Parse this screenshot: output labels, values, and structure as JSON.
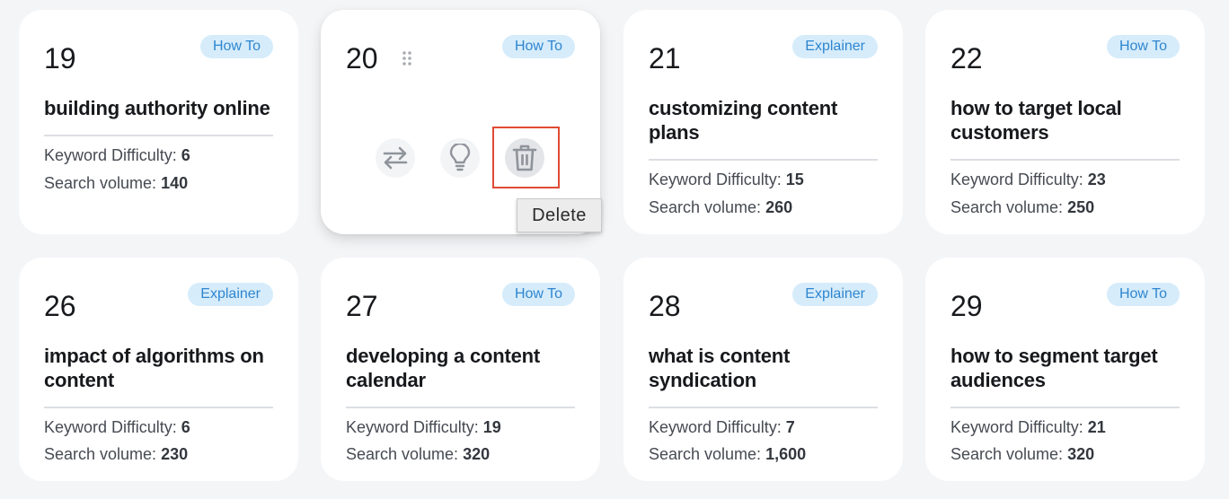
{
  "cards": [
    {
      "number": "19",
      "tag": "How To",
      "title": "building authority online",
      "kd_label": "Keyword Difficulty:",
      "kd": "6",
      "sv_label": "Search volume:",
      "sv": "140"
    },
    {
      "number": "20",
      "tag": "How To",
      "title": "",
      "kd_label": "",
      "kd": "",
      "sv_label": "",
      "sv": ""
    },
    {
      "number": "21",
      "tag": "Explainer",
      "title": "customizing content plans",
      "kd_label": "Keyword Difficulty:",
      "kd": "15",
      "sv_label": "Search volume:",
      "sv": "260"
    },
    {
      "number": "22",
      "tag": "How To",
      "title": "how to target local customers",
      "kd_label": "Keyword Difficulty:",
      "kd": "23",
      "sv_label": "Search volume:",
      "sv": "250"
    },
    {
      "number": "26",
      "tag": "Explainer",
      "title": "impact of algorithms on content",
      "kd_label": "Keyword Difficulty:",
      "kd": "6",
      "sv_label": "Search volume:",
      "sv": "230"
    },
    {
      "number": "27",
      "tag": "How To",
      "title": "developing a content calendar",
      "kd_label": "Keyword Difficulty:",
      "kd": "19",
      "sv_label": "Search volume:",
      "sv": "320"
    },
    {
      "number": "28",
      "tag": "Explainer",
      "title": "what is content syndication",
      "kd_label": "Keyword Difficulty:",
      "kd": "7",
      "sv_label": "Search volume:",
      "sv": "1,600"
    },
    {
      "number": "29",
      "tag": "How To",
      "title": "how to segment target audiences",
      "kd_label": "Keyword Difficulty:",
      "kd": "21",
      "sv_label": "Search volume:",
      "sv": "320"
    }
  ],
  "hover_actions": {
    "icons": [
      "swap-arrows-icon",
      "lightbulb-icon",
      "trash-icon"
    ],
    "tooltip": "Delete"
  },
  "colors": {
    "background": "#f4f5f7",
    "badge_bg": "#d6ecfb",
    "badge_text": "#2f86cf",
    "highlight": "#e04a33"
  }
}
